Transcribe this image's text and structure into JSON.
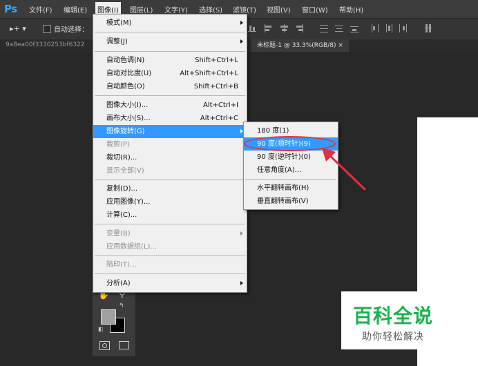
{
  "app": {
    "logo": "Ps"
  },
  "menubar": {
    "items": [
      {
        "label": "文件(F)"
      },
      {
        "label": "编辑(E)"
      },
      {
        "label": "图像(I)"
      },
      {
        "label": "图层(L)"
      },
      {
        "label": "文字(Y)"
      },
      {
        "label": "选择(S)"
      },
      {
        "label": "滤镜(T)"
      },
      {
        "label": "视图(V)"
      },
      {
        "label": "窗口(W)"
      },
      {
        "label": "帮助(H)"
      }
    ]
  },
  "options_bar": {
    "move_tool_glyph": "▸+ ▾",
    "auto_select_label": "自动选择："
  },
  "tabs": {
    "doc1": "9a8ea00f3330253bf6322",
    "doc2": "未标题-1 @ 33.3%(RGB/8)  ×"
  },
  "image_menu": {
    "items": [
      {
        "label": "模式(M)",
        "shortcut": ""
      },
      {
        "label": "调整(J)",
        "shortcut": ""
      },
      {
        "label": "自动色调(N)",
        "shortcut": "Shift+Ctrl+L"
      },
      {
        "label": "自动对比度(U)",
        "shortcut": "Alt+Shift+Ctrl+L"
      },
      {
        "label": "自动颜色(O)",
        "shortcut": "Shift+Ctrl+B"
      },
      {
        "label": "图像大小(I)...",
        "shortcut": "Alt+Ctrl+I"
      },
      {
        "label": "画布大小(S)...",
        "shortcut": "Alt+Ctrl+C"
      },
      {
        "label": "图像旋转(G)",
        "shortcut": ""
      },
      {
        "label": "裁剪(P)",
        "shortcut": ""
      },
      {
        "label": "裁切(R)...",
        "shortcut": ""
      },
      {
        "label": "显示全部(V)",
        "shortcut": ""
      },
      {
        "label": "复制(D)...",
        "shortcut": ""
      },
      {
        "label": "应用图像(Y)...",
        "shortcut": ""
      },
      {
        "label": "计算(C)...",
        "shortcut": ""
      },
      {
        "label": "变量(B)",
        "shortcut": ""
      },
      {
        "label": "应用数据组(L)...",
        "shortcut": ""
      },
      {
        "label": "陷印(T)...",
        "shortcut": ""
      },
      {
        "label": "分析(A)",
        "shortcut": ""
      }
    ]
  },
  "rotate_submenu": {
    "items": [
      {
        "label": "180 度(1)"
      },
      {
        "label": "90 度(顺时针)(9)"
      },
      {
        "label": "90 度(逆时针)(0)"
      },
      {
        "label": "任意角度(A)..."
      },
      {
        "label": "水平翻转画布(H)"
      },
      {
        "label": "垂直翻转画布(V)"
      }
    ]
  },
  "colors": {
    "menu_highlight": "#3399ff",
    "annotation": "#e03040",
    "watermark_green": "#19b24e",
    "ps_blue": "#31a8ff"
  },
  "watermark": {
    "title": "百科全说",
    "subtitle": "助你轻松解决"
  }
}
